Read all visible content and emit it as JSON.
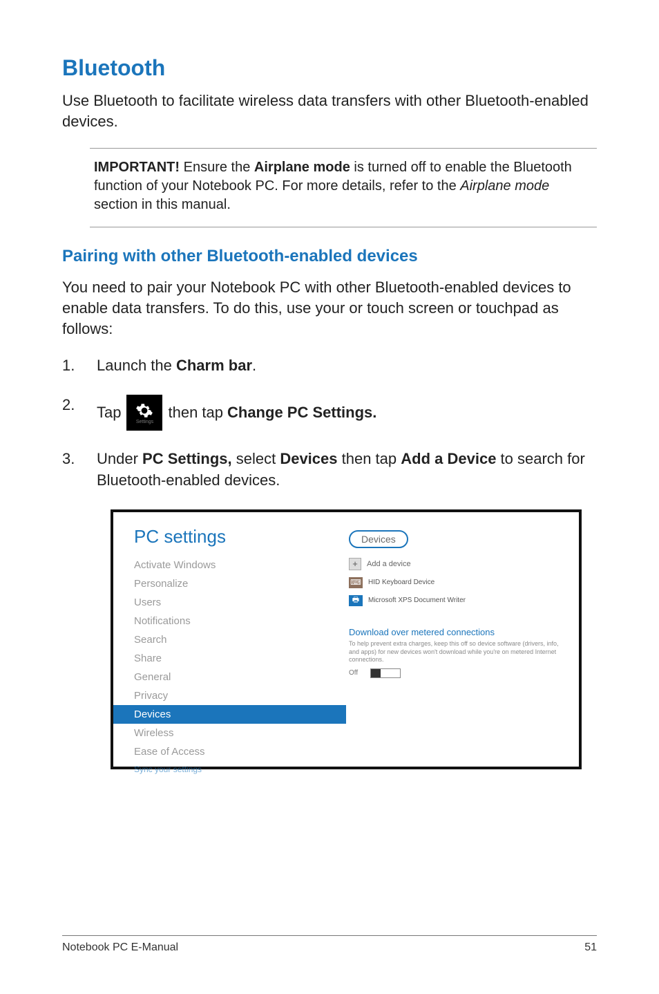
{
  "heading": "Bluetooth",
  "intro": "Use Bluetooth to facilitate wireless data transfers with other Bluetooth-enabled devices.",
  "callout": {
    "label": "IMPORTANT!",
    "text_a": " Ensure the ",
    "bold_a": "Airplane mode",
    "text_b": " is turned off to enable the Bluetooth function of your Notebook PC. For more details, refer to the ",
    "italic": "Airplane mode",
    "text_c": " section in this manual."
  },
  "subheading": "Pairing with other Bluetooth-enabled devices",
  "intro2": "You need to pair your Notebook PC with other Bluetooth-enabled devices to enable data transfers. To do this, use your or touch screen or touchpad as follows:",
  "steps": {
    "s1": {
      "num": "1.",
      "pre": "Launch the ",
      "bold": "Charm bar",
      "post": "."
    },
    "s2": {
      "num": "2.",
      "pre": "Tap ",
      "icon_label": "Settings",
      "mid": " then tap ",
      "bold": "Change PC Settings."
    },
    "s3": {
      "num": "3.",
      "pre": "Under ",
      "b1": "PC Settings,",
      "mid1": " select ",
      "b2": "Devices",
      "mid2": " then tap ",
      "b3": "Add a Device",
      "post": " to search for Bluetooth-enabled devices."
    }
  },
  "screenshot": {
    "title": "PC settings",
    "nav": {
      "i0": "Activate Windows",
      "i1": "Personalize",
      "i2": "Users",
      "i3": "Notifications",
      "i4": "Search",
      "i5": "Share",
      "i6": "General",
      "i7": "Privacy",
      "i8": "Devices",
      "i9": "Wireless",
      "i10": "Ease of Access",
      "i11": "Sync your settings"
    },
    "right": {
      "circled": "Devices",
      "add": "Add a device",
      "d1": "HID Keyboard Device",
      "d2": "Microsoft XPS Document Writer",
      "dl_head": "Download over metered connections",
      "dl_desc": "To help prevent extra charges, keep this off so device software (drivers, info, and apps) for new devices won't download while you're on metered Internet connections.",
      "toggle_label": "Off"
    }
  },
  "footer": {
    "left": "Notebook PC E-Manual",
    "right": "51"
  }
}
